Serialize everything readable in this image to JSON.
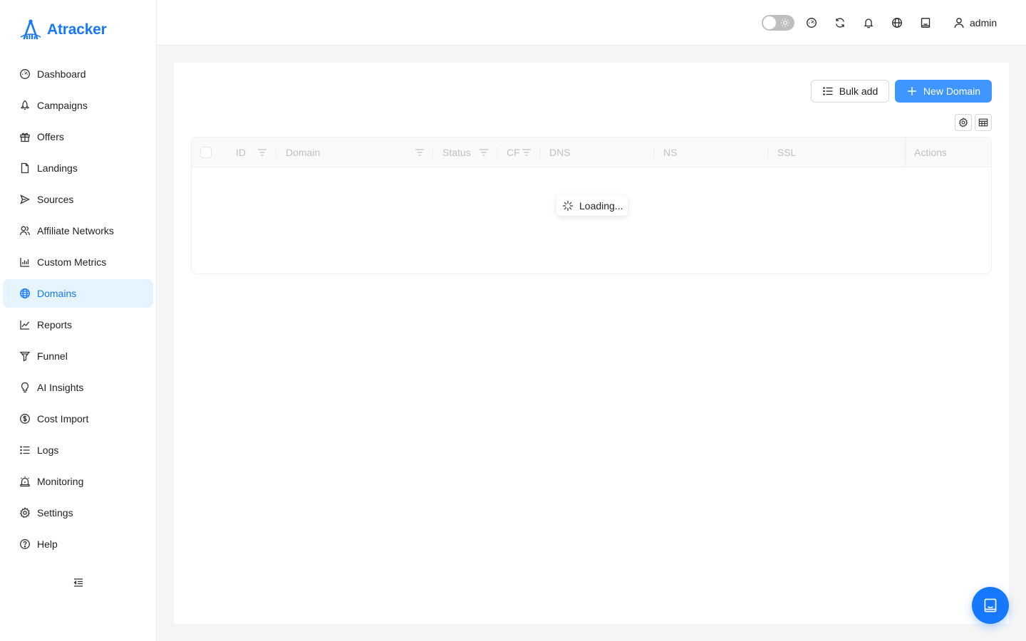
{
  "app": {
    "name": "Atracker",
    "accent": "#1677ff"
  },
  "sidebar": {
    "items": [
      {
        "label": "Dashboard",
        "icon": "dashboard-icon"
      },
      {
        "label": "Campaigns",
        "icon": "rocket-icon"
      },
      {
        "label": "Offers",
        "icon": "gift-icon"
      },
      {
        "label": "Landings",
        "icon": "file-icon"
      },
      {
        "label": "Sources",
        "icon": "send-icon"
      },
      {
        "label": "Affiliate Networks",
        "icon": "users-icon"
      },
      {
        "label": "Custom Metrics",
        "icon": "bar-chart-icon"
      },
      {
        "label": "Domains",
        "icon": "globe-icon",
        "active": true
      },
      {
        "label": "Reports",
        "icon": "line-chart-icon"
      },
      {
        "label": "Funnel",
        "icon": "funnel-icon"
      },
      {
        "label": "AI Insights",
        "icon": "bulb-icon"
      },
      {
        "label": "Cost Import",
        "icon": "dollar-icon"
      },
      {
        "label": "Logs",
        "icon": "list-icon"
      },
      {
        "label": "Monitoring",
        "icon": "alarm-icon"
      },
      {
        "label": "Settings",
        "icon": "gear-icon"
      },
      {
        "label": "Help",
        "icon": "question-icon"
      }
    ],
    "collapse_icon": "menu-fold-icon"
  },
  "header": {
    "theme_toggle": "off",
    "icons": [
      "dashboard-icon",
      "refresh-icon",
      "bell-icon",
      "globe-icon",
      "assistant-icon"
    ],
    "user": "admin"
  },
  "toolbar": {
    "bulk_add_label": "Bulk add",
    "new_domain_label": "New Domain"
  },
  "table": {
    "columns": [
      "ID",
      "Domain",
      "Status",
      "CF",
      "DNS",
      "NS",
      "SSL",
      "Actions"
    ],
    "loading_text": "Loading..."
  }
}
